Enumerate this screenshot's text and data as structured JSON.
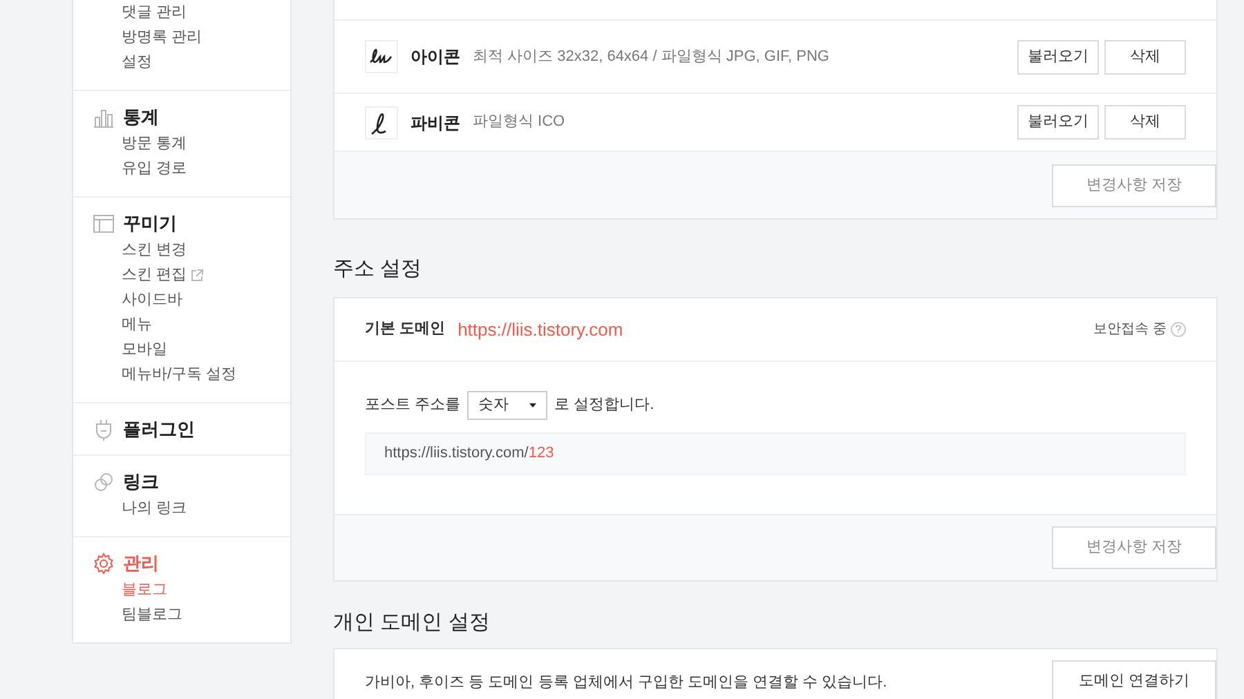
{
  "sidebar": {
    "groups": [
      {
        "items": [
          {
            "label": "댓글 관리",
            "selected": false,
            "external": false
          },
          {
            "label": "방명록 관리",
            "selected": false,
            "external": false
          },
          {
            "label": "설정",
            "selected": false,
            "external": false
          }
        ]
      },
      {
        "title": "통계",
        "items": [
          {
            "label": "방문 통계",
            "selected": false,
            "external": false
          },
          {
            "label": "유입 경로",
            "selected": false,
            "external": false
          }
        ]
      },
      {
        "title": "꾸미기",
        "items": [
          {
            "label": "스킨 변경",
            "selected": false,
            "external": false
          },
          {
            "label": "스킨 편집",
            "selected": false,
            "external": true
          },
          {
            "label": "사이드바",
            "selected": false,
            "external": false
          },
          {
            "label": "메뉴",
            "selected": false,
            "external": false
          },
          {
            "label": "모바일",
            "selected": false,
            "external": false
          },
          {
            "label": "메뉴바/구독 설정",
            "selected": false,
            "external": false
          }
        ]
      },
      {
        "title": "플러그인"
      },
      {
        "title": "링크",
        "items": [
          {
            "label": "나의 링크",
            "selected": false,
            "external": false
          }
        ]
      },
      {
        "title": "관리",
        "items": [
          {
            "label": "블로그",
            "selected": true,
            "external": false
          },
          {
            "label": "팀블로그",
            "selected": false,
            "external": false
          }
        ]
      }
    ]
  },
  "icon_card": {
    "rows": [
      {
        "title": "아이콘",
        "description": "최적 사이즈 32x32, 64x64 / 파일형식 JPG, GIF, PNG",
        "buttons": [
          "불러오기",
          "삭제"
        ]
      },
      {
        "title": "파비콘",
        "description": "파일형식 ICO",
        "buttons": [
          "불러오기",
          "삭제"
        ]
      }
    ],
    "save_button": "변경사항 저장"
  },
  "address": {
    "heading": "주소 설정",
    "domain_label": "기본 도메인",
    "domain": "https://liis.tistory.com",
    "secure_label": "보안접속 중",
    "help_icon": "?",
    "post_prefix": "포스트 주소를",
    "select_value": "숫자",
    "post_suffix": "로 설정합니다.",
    "preview_base": "https://liis.tistory.com/",
    "preview_tail": "123",
    "save_button": "변경사항 저장"
  },
  "custom_domain": {
    "heading": "개인 도메인 설정",
    "description": "가비아, 후이즈 등 도메인 등록 업체에서 구입한 도메인을 연결할 수 있습니다.",
    "button": "도메인 연결하기"
  }
}
